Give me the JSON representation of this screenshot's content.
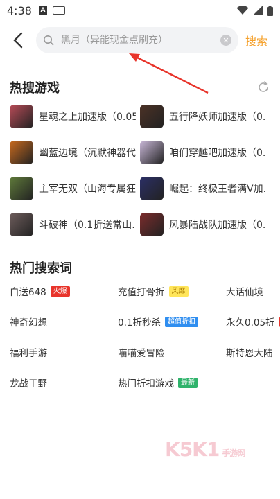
{
  "status": {
    "time": "4:38",
    "icon_a": "A"
  },
  "search": {
    "placeholder": "黑月（异能现金点刷充）",
    "button_label": "搜索"
  },
  "hot_games": {
    "title": "热搜游戏",
    "items": [
      {
        "name": "星魂之上加速版（0.05...",
        "color": "#b84b57"
      },
      {
        "name": "五行降妖师加速版（0....",
        "color": "#4c3226"
      },
      {
        "name": "幽蓝边境（沉默神器代...",
        "color": "#c96a1e"
      },
      {
        "name": "咱们穿越吧加速版（0....",
        "color": "#c9b8d8"
      },
      {
        "name": "主宰无双（山海专属狂...",
        "color": "#5f7a3a"
      },
      {
        "name": "崛起：终极王者满V加...",
        "color": "#2b2f66"
      },
      {
        "name": "斗破神（0.1折送常山...",
        "color": "#6e5d5c"
      },
      {
        "name": "风暴陆战队加速版（0....",
        "color": "#7c2c2c"
      }
    ]
  },
  "hot_keywords": {
    "title": "热门搜索词",
    "items": [
      {
        "text": "白送648",
        "tag": "火爆",
        "tag_type": "hot"
      },
      {
        "text": "充值打骨折",
        "tag": "风靡",
        "tag_type": "feature"
      },
      {
        "text": "大话仙境",
        "tag": "",
        "tag_type": ""
      },
      {
        "text": "神奇幻想",
        "tag": "",
        "tag_type": ""
      },
      {
        "text": "0.1折秒杀",
        "tag": "超值折扣",
        "tag_type": "discount"
      },
      {
        "text": "永久0.05折",
        "tag": "",
        "tag_type": "edge"
      },
      {
        "text": "福利手游",
        "tag": "",
        "tag_type": ""
      },
      {
        "text": "喵喵爱冒险",
        "tag": "",
        "tag_type": ""
      },
      {
        "text": "斯特恩大陆",
        "tag": "",
        "tag_type": ""
      },
      {
        "text": "龙战于野",
        "tag": "",
        "tag_type": ""
      },
      {
        "text": "热门折扣游戏",
        "tag": "最新",
        "tag_type": "new"
      }
    ]
  },
  "watermark": {
    "text": "K5K1",
    "suffix": "手游网"
  }
}
